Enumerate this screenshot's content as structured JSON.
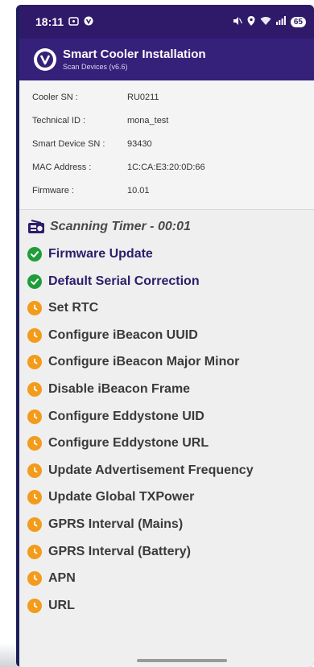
{
  "statusbar": {
    "time": "18:11",
    "battery": "65"
  },
  "appbar": {
    "title": "Smart Cooler Installation",
    "subtitle": "Scan Devices (v6.6)"
  },
  "info": [
    {
      "label": "Cooler SN :",
      "value": "RU0211"
    },
    {
      "label": "Technical ID :",
      "value": "mona_test"
    },
    {
      "label": "Smart Device SN :",
      "value": "93430"
    },
    {
      "label": "MAC Address :",
      "value": "1C:CA:E3:20:0D:66"
    },
    {
      "label": "Firmware :",
      "value": "10.01"
    }
  ],
  "timer": {
    "label": "Scanning Timer - 00:01",
    "icon": "radio-icon"
  },
  "steps": [
    {
      "label": "Firmware Update",
      "status": "done"
    },
    {
      "label": "Default Serial Correction",
      "status": "done"
    },
    {
      "label": "Set RTC",
      "status": "pending"
    },
    {
      "label": "Configure iBeacon UUID",
      "status": "pending"
    },
    {
      "label": "Configure iBeacon Major Minor",
      "status": "pending"
    },
    {
      "label": "Disable iBeacon Frame",
      "status": "pending"
    },
    {
      "label": "Configure Eddystone UID",
      "status": "pending"
    },
    {
      "label": "Configure Eddystone URL",
      "status": "pending"
    },
    {
      "label": "Update Advertisement Frequency",
      "status": "pending"
    },
    {
      "label": "Update Global TXPower",
      "status": "pending"
    },
    {
      "label": "GPRS Interval (Mains)",
      "status": "pending"
    },
    {
      "label": "GPRS Interval (Battery)",
      "status": "pending"
    },
    {
      "label": "APN",
      "status": "pending"
    },
    {
      "label": "URL",
      "status": "pending"
    }
  ],
  "colors": {
    "done": "#1f9d3a",
    "pending": "#f39b1b",
    "header": "#35207a"
  }
}
